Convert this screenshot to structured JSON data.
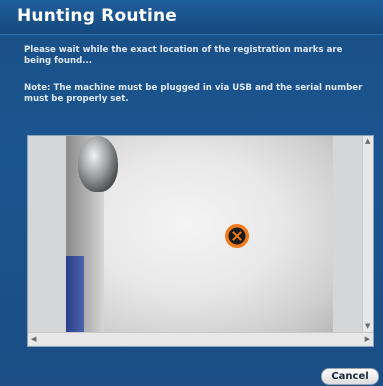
{
  "window": {
    "title": "Hunting Routine"
  },
  "messages": {
    "wait": "Please wait while the exact location of the registration marks are being found...",
    "note": "Note: The machine must be plugged in via USB and the serial number must be properly set."
  },
  "viewer": {
    "target_icon": "crosshair-target-icon"
  },
  "buttons": {
    "cancel": "Cancel"
  },
  "colors": {
    "accent": "#1a4f86",
    "target": "#f07a1a"
  }
}
